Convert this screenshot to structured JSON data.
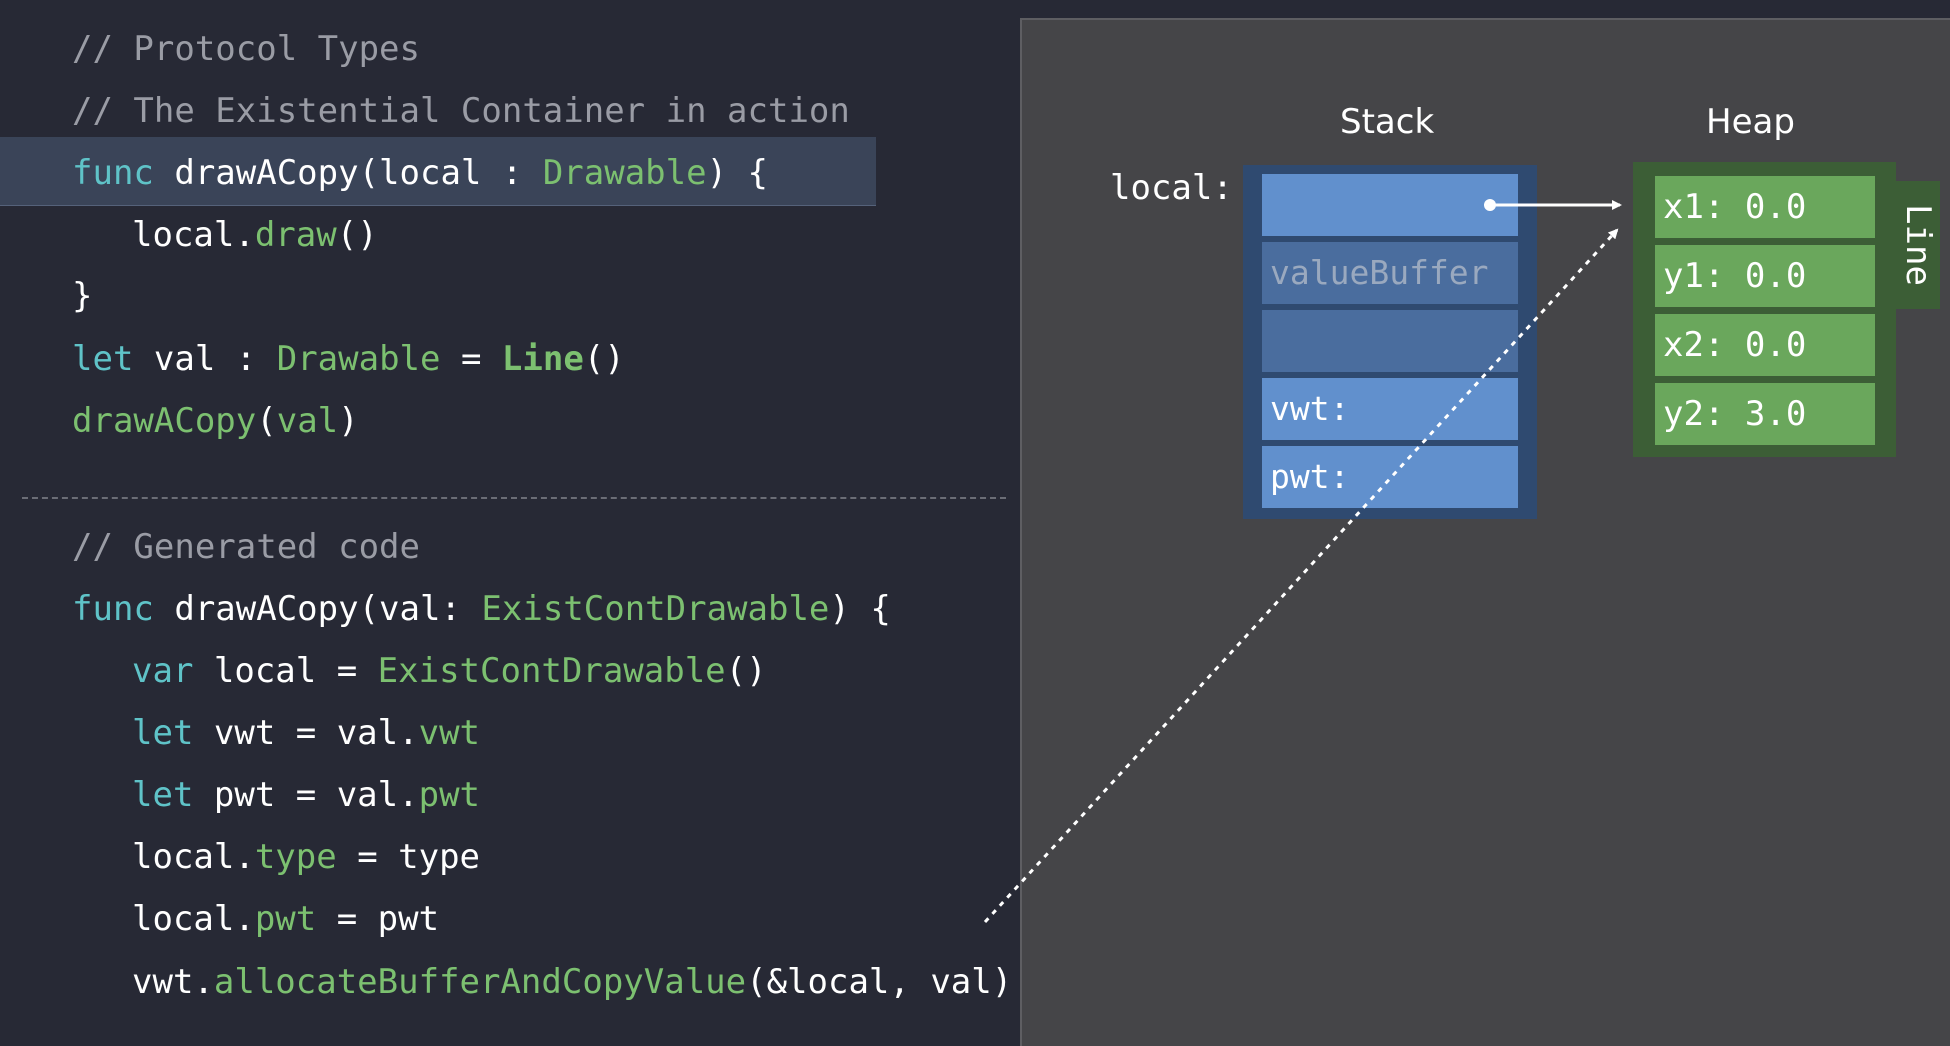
{
  "code_top": {
    "comment1": "// Protocol Types",
    "comment2": "// The Existential Container in action",
    "l3_kw": "func",
    "l3_a": " drawACopy(local : ",
    "l3_type": "Drawable",
    "l3_b": ") {",
    "l4_a": "local.",
    "l4_fn": "draw",
    "l4_b": "()",
    "l5": "}",
    "l6_kw": "let",
    "l6_a": " val : ",
    "l6_type": "Drawable",
    "l6_b": " = ",
    "l6_ctor": "Line",
    "l6_c": "()",
    "l7_fn": "drawACopy",
    "l7_a": "(",
    "l7_arg": "val",
    "l7_b": ")"
  },
  "code_bottom": {
    "comment": "// Generated code",
    "l1_kw": "func",
    "l1_a": " drawACopy(val: ",
    "l1_type": "ExistContDrawable",
    "l1_b": ") {",
    "l2_kw": "var",
    "l2_a": " local = ",
    "l2_type": "ExistContDrawable",
    "l2_b": "()",
    "l3_kw": "let",
    "l3_a": " vwt = val.",
    "l3_prop": "vwt",
    "l4_kw": "let",
    "l4_a": " pwt = val.",
    "l4_prop": "pwt",
    "l5_a": "local.",
    "l5_prop": "type",
    "l5_b": " = type",
    "l6_a": "local.",
    "l6_prop": "pwt",
    "l6_b": " = pwt",
    "l7_a": "vwt.",
    "l7_fn": "allocateBufferAndCopyValue",
    "l7_b": "(&local, val)"
  },
  "diagram": {
    "stack_title": "Stack",
    "heap_title": "Heap",
    "local_label": "local:",
    "stack_cells": [
      "",
      "valueBuffer",
      "",
      "vwt:",
      "pwt:"
    ],
    "heap_type_label": "Line",
    "heap_cells": [
      "x1: 0.0",
      "y1: 0.0",
      "x2: 0.0",
      "y2: 3.0"
    ]
  },
  "colors": {
    "background": "#272935",
    "keyword": "#5fc3c8",
    "type": "#7cc070",
    "comment": "#9a9ca5",
    "stack_cell": "#6190cd",
    "heap_cell": "#6aa75c"
  }
}
